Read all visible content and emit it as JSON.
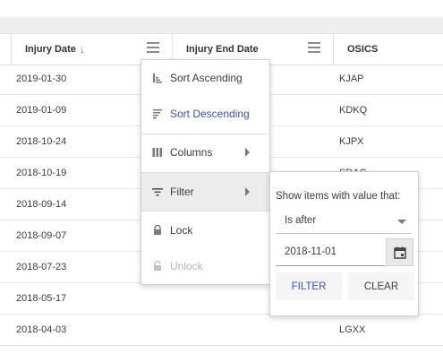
{
  "grid": {
    "columns": [
      {
        "label": "Injury Date",
        "sort_indicator": "↓"
      },
      {
        "label": "Injury End Date"
      },
      {
        "label": "OSICS"
      }
    ],
    "rows": [
      {
        "injury_date": "2019-01-30",
        "osics": "KJAP"
      },
      {
        "injury_date": "2019-01-09",
        "osics": "KDKQ"
      },
      {
        "injury_date": "2018-10-24",
        "osics": "KJPX"
      },
      {
        "injury_date": "2018-10-19",
        "osics": "SDAC"
      },
      {
        "injury_date": "2018-09-14",
        "osics": ""
      },
      {
        "injury_date": "2018-09-07",
        "osics": ""
      },
      {
        "injury_date": "2018-07-23",
        "osics": ""
      },
      {
        "injury_date": "2018-05-17",
        "osics": ""
      },
      {
        "injury_date": "2018-04-03",
        "osics": "LGXX"
      }
    ]
  },
  "column_menu": {
    "sort_ascending": "Sort Ascending",
    "sort_descending": "Sort Descending",
    "columns": "Columns",
    "filter": "Filter",
    "lock": "Lock",
    "unlock": "Unlock"
  },
  "filter_panel": {
    "prompt": "Show items with value that:",
    "operator": "Is after",
    "value": "2018-11-01",
    "filter_button": "FILTER",
    "clear_button": "CLEAR"
  },
  "colors": {
    "accent": "#3f51b5",
    "header_band": "#efefef",
    "active_menu_bg": "#ececec"
  },
  "icons": [
    "column-menu-icon",
    "sort-ascending-icon",
    "sort-descending-icon",
    "columns-icon",
    "filter-icon",
    "lock-icon",
    "unlock-icon",
    "calendar-icon",
    "chevron-right-icon",
    "dropdown-caret-icon"
  ]
}
